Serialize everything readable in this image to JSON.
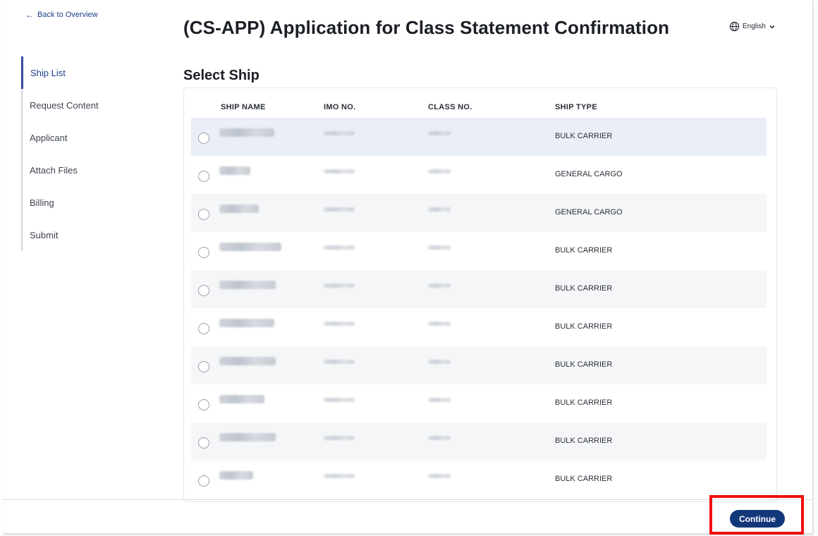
{
  "nav": {
    "back_label": "Back to Overview"
  },
  "header": {
    "title": "(CS-APP) Application for Class Statement Confirmation",
    "language": "English"
  },
  "steps": [
    {
      "label": "Ship List",
      "active": true
    },
    {
      "label": "Request Content",
      "active": false
    },
    {
      "label": "Applicant",
      "active": false
    },
    {
      "label": "Attach Files",
      "active": false
    },
    {
      "label": "Billing",
      "active": false
    },
    {
      "label": "Submit",
      "active": false
    }
  ],
  "section_title": "Select Ship",
  "table": {
    "columns": [
      "SHIP NAME",
      "IMO NO.",
      "CLASS NO.",
      "SHIP TYPE"
    ],
    "rows": [
      {
        "ship_type": "BULK CARRIER"
      },
      {
        "ship_type": "GENERAL CARGO"
      },
      {
        "ship_type": "GENERAL CARGO"
      },
      {
        "ship_type": "BULK CARRIER"
      },
      {
        "ship_type": "BULK CARRIER"
      },
      {
        "ship_type": "BULK CARRIER"
      },
      {
        "ship_type": "BULK CARRIER"
      },
      {
        "ship_type": "BULK CARRIER"
      },
      {
        "ship_type": "BULK CARRIER"
      },
      {
        "ship_type": "BULK CARRIER"
      }
    ]
  },
  "footer": {
    "continue_label": "Continue"
  },
  "colors": {
    "primary": "#13387a",
    "highlight_box": "#f20e0e",
    "selected_row": "#e9eef7"
  }
}
